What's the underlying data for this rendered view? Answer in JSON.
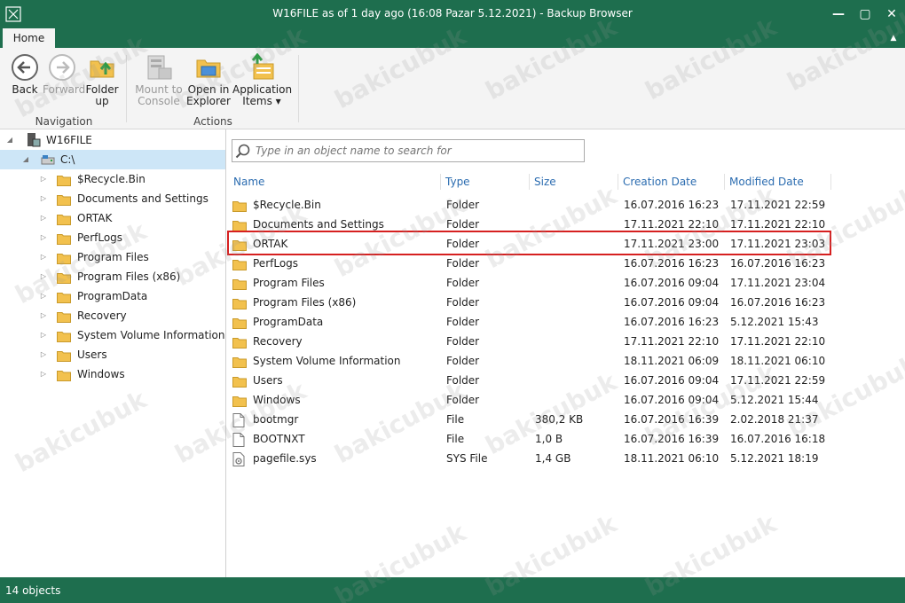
{
  "window": {
    "title": "W16FILE as of 1 day ago (16:08 Pazar 5.12.2021) - Backup Browser"
  },
  "tabs": {
    "home": "Home"
  },
  "ribbon": {
    "back": "Back",
    "forward": "Forward",
    "folder_up_1": "Folder",
    "folder_up_2": "up",
    "mount_1": "Mount to",
    "mount_2": "Console",
    "open_1": "Open in",
    "open_2": "Explorer",
    "app_1": "Application",
    "app_2": "Items ▾",
    "group_navigation": "Navigation",
    "group_actions": "Actions"
  },
  "tree": {
    "root": "W16FILE",
    "drive": "C:\\",
    "items": [
      "$Recycle.Bin",
      "Documents and Settings",
      "ORTAK",
      "PerfLogs",
      "Program Files",
      "Program Files (x86)",
      "ProgramData",
      "Recovery",
      "System Volume Information",
      "Users",
      "Windows"
    ]
  },
  "search": {
    "placeholder": "Type in an object name to search for"
  },
  "columns": {
    "name": "Name",
    "type": "Type",
    "size": "Size",
    "created": "Creation Date",
    "modified": "Modified Date"
  },
  "rows": [
    {
      "name": "$Recycle.Bin",
      "type": "Folder",
      "size": "",
      "created": "16.07.2016 16:23",
      "modified": "17.11.2021 22:59",
      "icon": "folder-icon"
    },
    {
      "name": "Documents and Settings",
      "type": "Folder",
      "size": "",
      "created": "17.11.2021 22:10",
      "modified": "17.11.2021 22:10",
      "icon": "folder-icon"
    },
    {
      "name": "ORTAK",
      "type": "Folder",
      "size": "",
      "created": "17.11.2021 23:00",
      "modified": "17.11.2021 23:03",
      "icon": "folder-icon"
    },
    {
      "name": "PerfLogs",
      "type": "Folder",
      "size": "",
      "created": "16.07.2016 16:23",
      "modified": "16.07.2016 16:23",
      "icon": "folder-icon"
    },
    {
      "name": "Program Files",
      "type": "Folder",
      "size": "",
      "created": "16.07.2016 09:04",
      "modified": "17.11.2021 23:04",
      "icon": "folder-icon"
    },
    {
      "name": "Program Files (x86)",
      "type": "Folder",
      "size": "",
      "created": "16.07.2016 09:04",
      "modified": "16.07.2016 16:23",
      "icon": "folder-icon"
    },
    {
      "name": "ProgramData",
      "type": "Folder",
      "size": "",
      "created": "16.07.2016 16:23",
      "modified": "5.12.2021 15:43",
      "icon": "folder-icon"
    },
    {
      "name": "Recovery",
      "type": "Folder",
      "size": "",
      "created": "17.11.2021 22:10",
      "modified": "17.11.2021 22:10",
      "icon": "folder-icon"
    },
    {
      "name": "System Volume Information",
      "type": "Folder",
      "size": "",
      "created": "18.11.2021 06:09",
      "modified": "18.11.2021 06:10",
      "icon": "folder-icon"
    },
    {
      "name": "Users",
      "type": "Folder",
      "size": "",
      "created": "16.07.2016 09:04",
      "modified": "17.11.2021 22:59",
      "icon": "folder-icon"
    },
    {
      "name": "Windows",
      "type": "Folder",
      "size": "",
      "created": "16.07.2016 09:04",
      "modified": "5.12.2021 15:44",
      "icon": "folder-icon"
    },
    {
      "name": "bootmgr",
      "type": "File",
      "size": "380,2 KB",
      "created": "16.07.2016 16:39",
      "modified": "2.02.2018 21:37",
      "icon": "file-icon"
    },
    {
      "name": "BOOTNXT",
      "type": "File",
      "size": "1,0 B",
      "created": "16.07.2016 16:39",
      "modified": "16.07.2016 16:18",
      "icon": "file-icon"
    },
    {
      "name": "pagefile.sys",
      "type": "SYS File",
      "size": "1,4 GB",
      "created": "18.11.2021 06:10",
      "modified": "5.12.2021 18:19",
      "icon": "system-file-icon"
    }
  ],
  "status": {
    "count": "14 objects"
  },
  "watermark": "bakicubuk",
  "colors": {
    "titlebar": "#1e6e4e",
    "header_text": "#2b6cb0",
    "selection": "#cde6f7",
    "highlight": "#d62020",
    "folder": "#f2c14e"
  }
}
